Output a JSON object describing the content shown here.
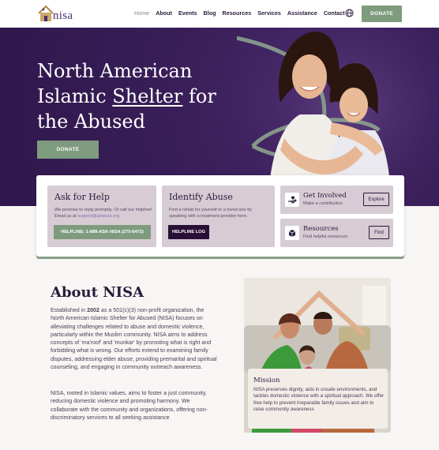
{
  "nav": {
    "logo_text": "nisa",
    "items": [
      {
        "label": "Home",
        "active": true
      },
      {
        "label": "About",
        "active": false
      },
      {
        "label": "Events",
        "active": false
      },
      {
        "label": "Blog",
        "active": false
      },
      {
        "label": "Resources",
        "active": false
      },
      {
        "label": "Services",
        "active": false
      },
      {
        "label": "Assistance",
        "active": false
      },
      {
        "label": "Contact",
        "active": false
      }
    ],
    "language_icon": "globe-icon",
    "donate_label": "DONATE"
  },
  "hero": {
    "title_line1": "North American",
    "title_pre": "Islamic ",
    "title_underlined": "Shelter",
    "title_post": " for",
    "title_line3": "the Abused",
    "donate_label": "DONATE"
  },
  "cards": {
    "ask": {
      "title": "Ask for Help",
      "desc_pre": "We promise to reply promptly. Or call our helpline! Email us at ",
      "desc_email": "support@askniza.org",
      "button": "HELPLINE: 1-888-ASK-NISA (275-6472)"
    },
    "identify": {
      "title": "Identify Abuse",
      "desc": "Find a rehab for yourself or a loved one by speaking with a treatment provider here.",
      "button": "HELPLINE LOG"
    },
    "involved": {
      "title": "Get Involved",
      "sub": "Make a contribution",
      "button": "Explore"
    },
    "resources": {
      "title": "Resources",
      "sub": "Find helpful resources",
      "button": "Find"
    }
  },
  "about": {
    "title": "About NISA",
    "p1_pre": "Established in ",
    "p1_year": "2002",
    "p1_post": " as a 501(c)(3) non-profit organization, the North American Islamic Shelter for Abused (NISA) focuses on alleviating challenges related to abuse and domestic violence, particularly within the Muslim community. NISA aims to address concepts of 'ma'roof' and 'munkar' by promoting what is right and forbidding what is wrong. Our efforts extend to examining family disputes, addressing elder abuse, providing premarital and spiritual counseling, and engaging in community outreach awareness.",
    "p2": "NISA, rooted in Islamic values, aims to foster a just community, reducing domestic violence and promoting harmony. We collaborate with the community and organizations, offering non-discriminatory services to all seeking assistance",
    "mission_title": "Mission",
    "mission_text": "NISA preserves dignity, aids in unsafe environments, and tackles domestic violence with a spiritual approach. We offer free help to prevent irreparable family issues and aim to raise community awareness"
  },
  "colors": {
    "brand_purple": "#3a1f5a",
    "accent_green": "#7e9b7e",
    "card_bg": "#d7cbd4",
    "dark_button": "#2a0f35"
  }
}
